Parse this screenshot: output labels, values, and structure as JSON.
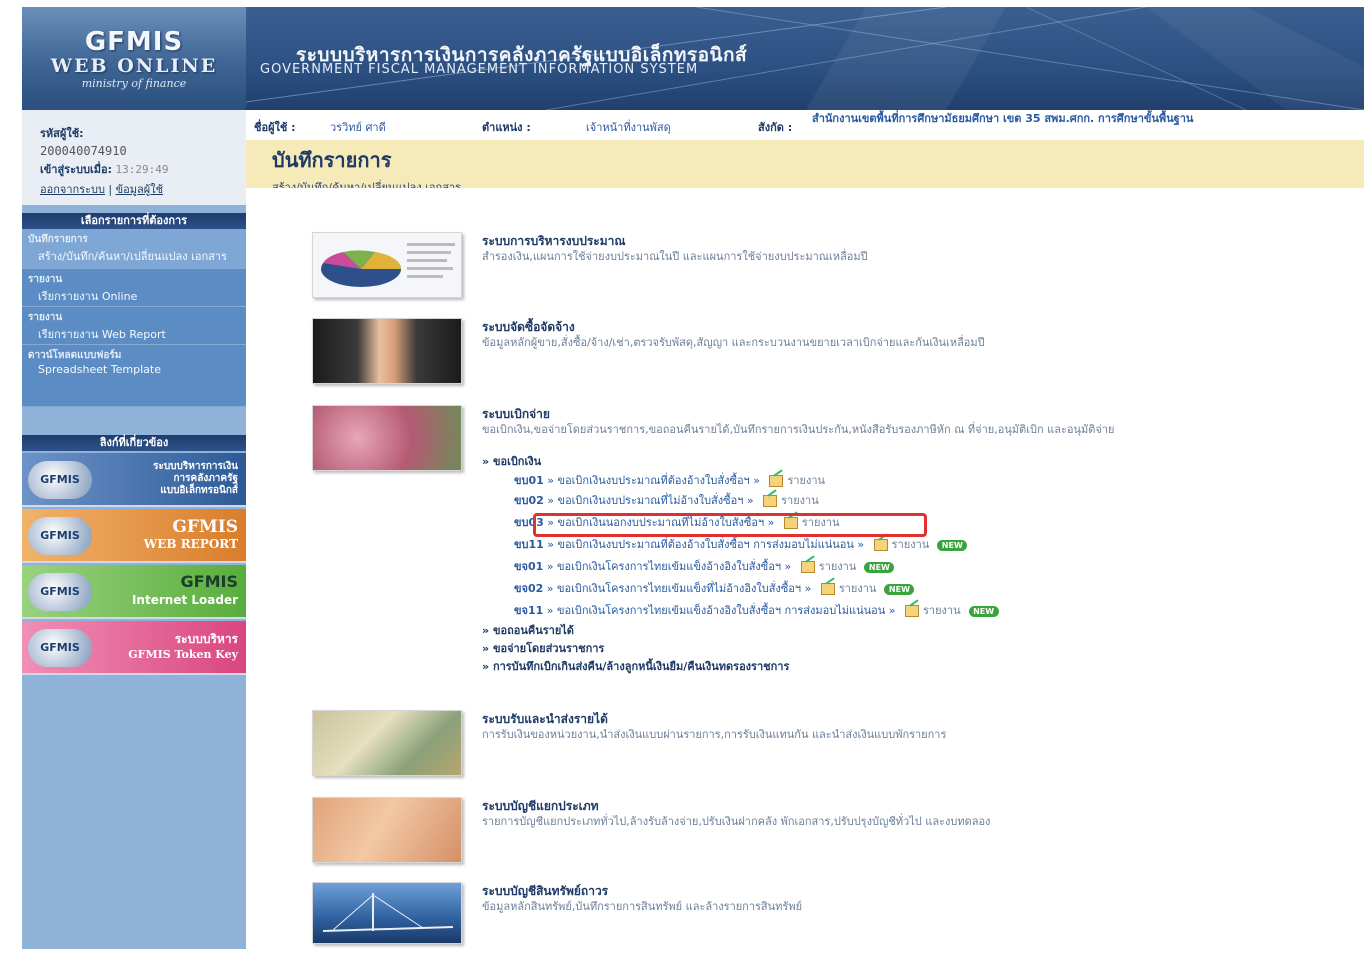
{
  "header": {
    "logo_line1": "GFMIS",
    "logo_line2": "WEB ONLINE",
    "logo_line3": "ministry of finance",
    "title_th": "ระบบบริหารการเงินการคลังภาครัฐแบบอิเล็กทรอนิกส์",
    "title_en": "GOVERNMENT FISCAL MANAGEMENT INFORMATION SYSTEM"
  },
  "user": {
    "id_label": "รหัสผู้ใช้:",
    "id_value": "200040074910",
    "login_label": "เข้าสู่ระบบเมื่อ:",
    "login_time": "13:29:49",
    "logout": "ออกจากระบบ",
    "profile": "ข้อมูลผู้ใช้"
  },
  "infobar": {
    "user_label": "ชื่อผู้ใช้ :",
    "user_value": "วรวิทย์ ศาดี",
    "position_label": "ตำแหน่ง :",
    "position_value": "เจ้าหน้าที่งานพัสดุ",
    "org_label": "สังกัด :",
    "org_value": "สำนักงานเขตพื้นที่การศึกษามัธยมศึกษา เขต 35 สพม.ศกก. การศึกษาขั้นพื้นฐาน"
  },
  "page": {
    "title": "บันทึกรายการ",
    "subtitle": "สร้าง/บันทึก/ค้นหา/เปลี่ยนแปลง เอกสาร"
  },
  "sidebar": {
    "menu_head": "เลือกรายการที่ต้องการ",
    "items": [
      {
        "a": "บันทึกรายการ",
        "b": "สร้าง/บันทึก/ค้นหา/เปลี่ยนแปลง เอกสาร"
      },
      {
        "a": "รายงาน",
        "b": "เรียกรายงาน Online"
      },
      {
        "a": "รายงาน",
        "b": "เรียกรายงาน Web Report"
      },
      {
        "a": "ดาวน์โหลดแบบฟอร์ม",
        "b": "Spreadsheet Template"
      }
    ],
    "links_head": "ลิงก์ที่เกี่ยวข้อง",
    "links": [
      {
        "badge": "GFMIS",
        "line1": "ระบบบริหารการเงิน",
        "line2": "การคลังภาครัฐ",
        "line3": "แบบอิเล็กทรอนิกส์",
        "color": "#2d5a97"
      },
      {
        "badge": "GFMIS",
        "line1": "GFMIS",
        "line2": "WEB REPORT",
        "color": "#e0913a"
      },
      {
        "badge": "GFMIS",
        "line1": "GFMIS",
        "line2": "Internet Loader",
        "color": "#6cbf4d"
      },
      {
        "badge": "GFMIS",
        "line1": "ระบบบริหาร",
        "line2": "GFMIS Token Key",
        "color": "#e05a8f"
      }
    ]
  },
  "systems": [
    {
      "name": "ระบบการบริหารงบประมาณ",
      "desc": "สำรองเงิน,แผนการใช้จ่ายงบประมาณในปี และแผนการใช้จ่ายงบประมาณเหลื่อมปี"
    },
    {
      "name": "ระบบจัดซื้อจัดจ้าง",
      "desc": "ข้อมูลหลักผู้ขาย,สั่งซื้อ/จ้าง/เช่า,ตรวจรับพัสดุ,สัญญา และกระบวนงานขยายเวลาเบิกจ่ายและกันเงินเหลื่อมปี"
    },
    {
      "name": "ระบบเบิกจ่าย",
      "desc": "ขอเบิกเงิน,ขอจ่ายโดยส่วนราชการ,ขอถอนคืนรายได้,บันทึกรายการเงินประกัน,หนังสือรับรองภาษีหัก ณ ที่จ่าย,อนุมัติเบิก และอนุมัติจ่าย"
    },
    {
      "name": "ระบบรับและนำส่งรายได้",
      "desc": "การรับเงินของหน่วยงาน,นำส่งเงินแบบผ่านรายการ,การรับเงินแทนกัน และนำส่งเงินแบบพักรายการ"
    },
    {
      "name": "ระบบบัญชีแยกประเภท",
      "desc": "รายการบัญชีแยกประเภททั่วไป,ล้างรับล้างจ่าย,ปรับเงินฝากคลัง พักเอกสาร,ปรับปรุงบัญชีทั่วไป และงบทดลอง"
    },
    {
      "name": "ระบบบัญชีสินทรัพย์ถาวร",
      "desc": "ข้อมูลหลักสินทรัพย์,บันทึกรายการสินทรัพย์ และล้างรายการสินทรัพย์"
    }
  ],
  "withdraw": {
    "group": "ขอเบิกเงิน",
    "docs": [
      {
        "code": "ขบ01",
        "text": "ขอเบิกเงินงบประมาณที่ต้องอ้างใบสั่งซื้อฯ",
        "report": "รายงาน",
        "new": false
      },
      {
        "code": "ขบ02",
        "text": "ขอเบิกเงินงบประมาณที่ไม่อ้างใบสั่งซื้อฯ",
        "report": "รายงาน",
        "new": false
      },
      {
        "code": "ขบ03",
        "text": "ขอเบิกเงินนอกงบประมาณที่ไม่อ้างใบสั่งซื้อฯ",
        "report": "รายงาน",
        "new": false
      },
      {
        "code": "ขบ11",
        "text": "ขอเบิกเงินงบประมาณที่ต้องอ้างใบสั่งซื้อฯ การส่งมอบไม่แน่นอน",
        "report": "รายงาน",
        "new": true
      },
      {
        "code": "ขจ01",
        "text": "ขอเบิกเงินโครงการไทยเข้มแข็งอ้างอิงใบสั่งซื้อฯ",
        "report": "รายงาน",
        "new": true
      },
      {
        "code": "ขจ02",
        "text": "ขอเบิกเงินโครงการไทยเข้มแข็งที่ไม่อ้างอิงใบสั่งซื้อฯ",
        "report": "รายงาน",
        "new": true
      },
      {
        "code": "ขจ11",
        "text": "ขอเบิกเงินโครงการไทยเข้มแข็งอ้างอิงใบสั่งซื้อฯ การส่งมอบไม่แน่นอน",
        "report": "รายงาน",
        "new": true
      }
    ],
    "groups_more": [
      "ขอถอนคืนรายได้",
      "ขอจ่ายโดยส่วนราชการ",
      "การบันทึกเบิกเกินส่งคืน/ล้างลูกหนี้เงินยืม/คืนเงินทดรองราชการ"
    ],
    "new_label": "NEW"
  }
}
